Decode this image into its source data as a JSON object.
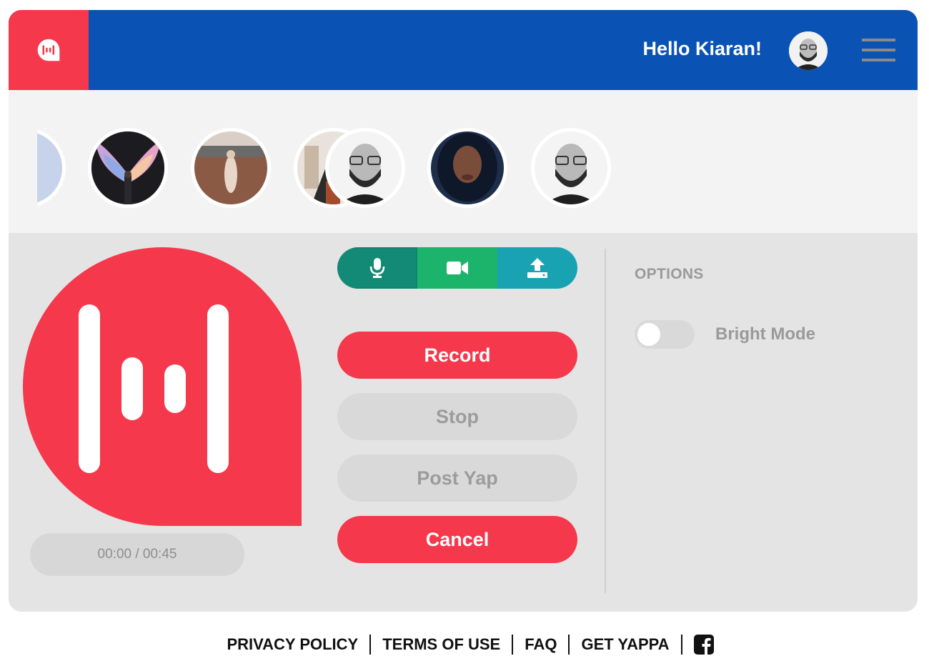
{
  "header": {
    "greeting": "Hello Kiaran!",
    "logo_icon": "yappa-logo-icon",
    "avatar_icon": "user-avatar",
    "menu_icon": "hamburger-menu-icon"
  },
  "carousel": {
    "arrow_icon": "chevron-left-icon",
    "avatars": [
      {
        "name": "partial-avatar",
        "photo": "pale blue"
      },
      {
        "name": "wings-mural-photo",
        "photo": "wings mural"
      },
      {
        "name": "street-photo",
        "photo": "street"
      },
      {
        "name": "outdoor-photo",
        "photo": "outdoor"
      },
      {
        "name": "bearded-man-photo",
        "photo": "bearded man"
      },
      {
        "name": "woman-photo",
        "photo": "woman"
      },
      {
        "name": "bearded-man-photo-2",
        "photo": "bearded man"
      }
    ]
  },
  "recorder": {
    "timer": "00:00 / 00:45",
    "modes": [
      {
        "name": "audio-mode",
        "icon": "microphone-icon"
      },
      {
        "name": "video-mode",
        "icon": "video-camera-icon"
      },
      {
        "name": "upload-mode",
        "icon": "upload-icon"
      }
    ],
    "record_label": "Record",
    "stop_label": "Stop",
    "post_label": "Post Yap",
    "cancel_label": "Cancel"
  },
  "options": {
    "title": "OPTIONS",
    "bright_mode_label": "Bright Mode",
    "bright_mode_on": false
  },
  "footer": {
    "links": [
      "PRIVACY POLICY",
      "TERMS OF USE",
      "FAQ",
      "GET YAPPA"
    ],
    "social_icon": "facebook-icon"
  },
  "colors": {
    "brand_red": "#f5384b",
    "header_blue": "#0a52b3",
    "audio_teal": "#138a76",
    "video_green": "#1cb36a",
    "upload_cyan": "#19a2b1"
  }
}
